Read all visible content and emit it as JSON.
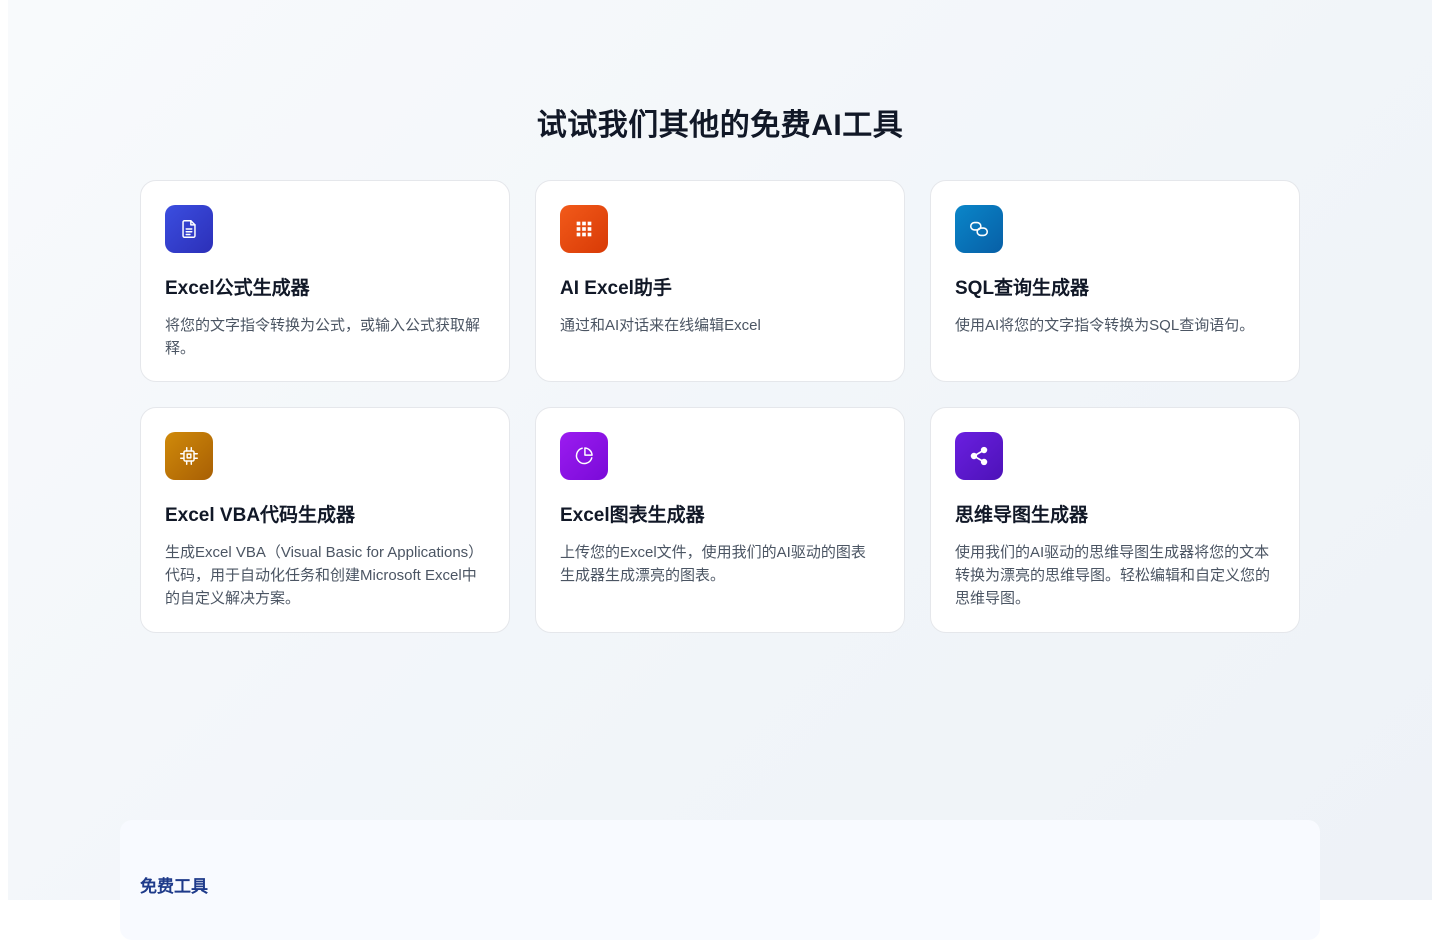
{
  "section": {
    "title": "试试我们其他的免费AI工具"
  },
  "tools": [
    {
      "title": "Excel公式生成器",
      "description": "将您的文字指令转换为公式，或输入公式获取解释。",
      "icon": "document-icon",
      "gradient_start": "#3b4ee0",
      "gradient_end": "#2c2fb8"
    },
    {
      "title": "AI Excel助手",
      "description": "通过和AI对话来在线编辑Excel",
      "icon": "grid-icon",
      "gradient_start": "#f25a1a",
      "gradient_end": "#d83a06"
    },
    {
      "title": "SQL查询生成器",
      "description": "使用AI将您的文字指令转换为SQL查询语句。",
      "icon": "link-icon",
      "gradient_start": "#0a86c9",
      "gradient_end": "#075fa6"
    },
    {
      "title": "Excel VBA代码生成器",
      "description": "生成Excel VBA（Visual Basic for Applications）代码，用于自动化任务和创建Microsoft Excel中的自定义解决方案。",
      "icon": "chip-icon",
      "gradient_start": "#d08a0a",
      "gradient_end": "#a85f04"
    },
    {
      "title": "Excel图表生成器",
      "description": "上传您的Excel文件，使用我们的AI驱动的图表生成器生成漂亮的图表。",
      "icon": "pie-chart-icon",
      "gradient_start": "#9b1cf0",
      "gradient_end": "#7a0ad8"
    },
    {
      "title": "思维导图生成器",
      "description": "使用我们的AI驱动的思维导图生成器将您的文本转换为漂亮的思维导图。轻松编辑和自定义您的思维导图。",
      "icon": "share-icon",
      "gradient_start": "#6a1fe0",
      "gradient_end": "#4d12b8"
    }
  ],
  "footer": {
    "heading": "免费工具"
  }
}
